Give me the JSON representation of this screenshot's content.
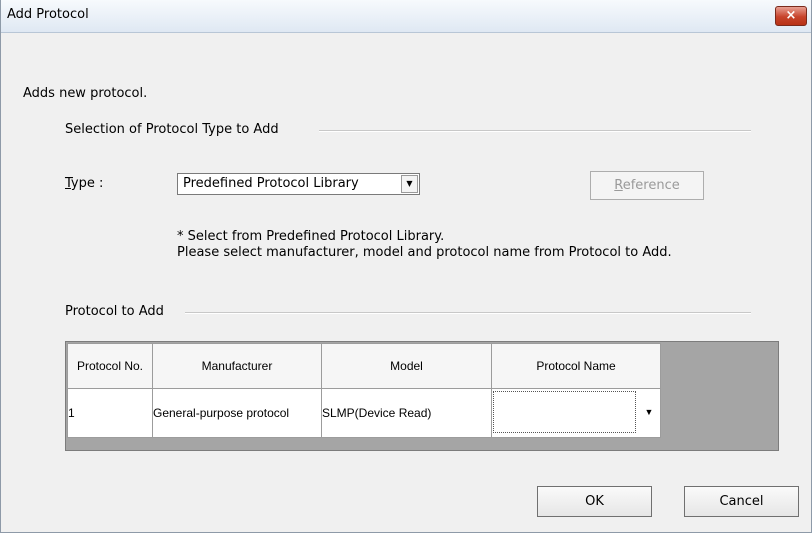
{
  "window": {
    "title": "Add Protocol",
    "close_label": "×"
  },
  "description": "Adds new protocol.",
  "selection_group": {
    "title": "Selection of Protocol Type to Add",
    "type_label": "Type :",
    "type_selected": "Predefined Protocol Library",
    "reference_label": "Reference",
    "note_line1": "* Select from Predefined Protocol Library.",
    "note_line2": "Please select manufacturer, model and protocol name from Protocol to Add."
  },
  "protocol_group": {
    "title": "Protocol to Add",
    "columns": [
      "Protocol No.",
      "Manufacturer",
      "Model",
      "Protocol Name"
    ],
    "rows": [
      {
        "no": "1",
        "manufacturer": "General-purpose protocol",
        "model": "SLMP(Device Read)",
        "protocol_name": ""
      }
    ]
  },
  "buttons": {
    "ok": "OK",
    "cancel": "Cancel"
  },
  "colors": {
    "close_button": "#c7432b",
    "grid_background": "#a5a5a5",
    "disabled_text": "#9a9a9a"
  },
  "icons": {
    "close": "close-icon",
    "dropdown": "chevron-down-icon"
  }
}
